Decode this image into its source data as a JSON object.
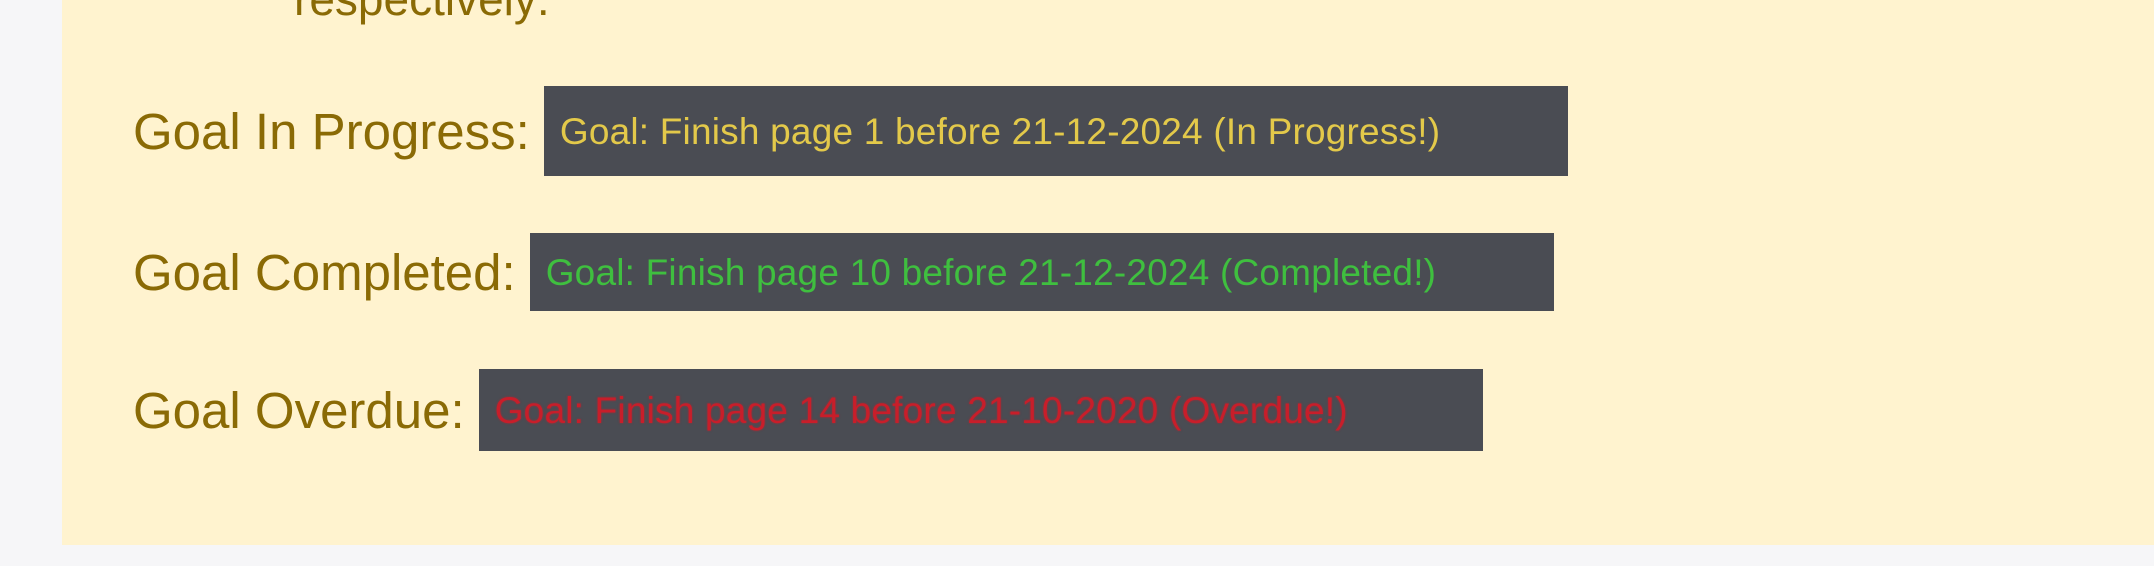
{
  "content": {
    "partial_line": "respectively:",
    "rows": [
      {
        "label": "Goal In Progress:",
        "chip_text": "Goal: Finish page 1 before 21-12-2024 (In Progress!)",
        "chip_color": "#e3c94a"
      },
      {
        "label": "Goal Completed:",
        "chip_text": "Goal: Finish page 10 before 21-12-2024 (Completed!)",
        "chip_color": "#3fbf3f"
      },
      {
        "label": "Goal Overdue:",
        "chip_text": "Goal: Finish page 14 before 21-10-2020 (Overdue!)",
        "chip_color": "#c81e2a"
      }
    ]
  },
  "colors": {
    "card_background": "#fff3cf",
    "text": "#8a6a05",
    "chip_background": "#4a4c53"
  }
}
